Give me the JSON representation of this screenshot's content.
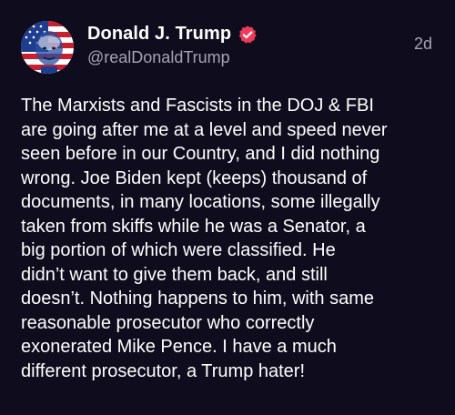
{
  "author": {
    "display_name": "Donald J. Trump",
    "handle": "@realDonaldTrump",
    "verified": true,
    "avatar_icon": "profile-photo-flag-icon"
  },
  "post": {
    "timestamp": "2d",
    "text": "The Marxists and Fascists in the DOJ & FBI\nare going after me at a level and speed never\nseen before in our Country, and I did nothing\nwrong. Joe Biden kept (keeps) thousand of\ndocuments, in many locations, some illegally\ntaken from skiffs while he was a Senator, a\nbig portion of which were classified. He\ndidn’t want to give them back, and still\ndoesn’t. Nothing happens to him, with same\nreasonable prosecutor who correctly\nexonerated Mike Pence. I have a much\ndifferent prosecutor, a Trump hater!"
  },
  "colors": {
    "background": "#0f0c1e",
    "text": "#ffffff",
    "secondary_text": "#a6a3b5",
    "verified_badge": "#ef3b5a"
  }
}
